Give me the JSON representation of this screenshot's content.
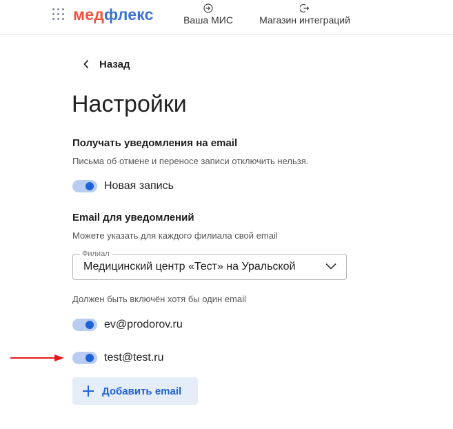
{
  "header": {
    "logo_part1": "мед",
    "logo_part2": "флекс",
    "nav": [
      {
        "label": "Ваша МИС",
        "icon": "login-icon"
      },
      {
        "label": "Магазин интеграций",
        "icon": "logout-icon"
      }
    ]
  },
  "back": {
    "label": "Назад"
  },
  "page_title": "Настройки",
  "notifications": {
    "title": "Получать уведомления на email",
    "hint": "Письма об отмене и переносе записи отключить нельзя.",
    "toggle_label": "Новая запись",
    "toggle_on": true
  },
  "email_section": {
    "title": "Email для уведомлений",
    "hint": "Можете указать для каждого филиала свой email",
    "branch_select": {
      "legend": "Филиал",
      "value": "Медицинский центр «Тест» на Уральской"
    },
    "required_hint": "Должен быть включён хотя бы один email",
    "emails": [
      {
        "address": "ev@prodorov.ru",
        "enabled": true
      },
      {
        "address": "test@test.ru",
        "enabled": true
      }
    ],
    "add_button": "Добавить email"
  },
  "colors": {
    "brand_red": "#f0523d",
    "brand_blue": "#3a72d6",
    "toggle_track": "#b9cdf2",
    "toggle_knob": "#1f62d6",
    "button_bg": "#e5edf8",
    "annotation_arrow": "#e8161b"
  }
}
